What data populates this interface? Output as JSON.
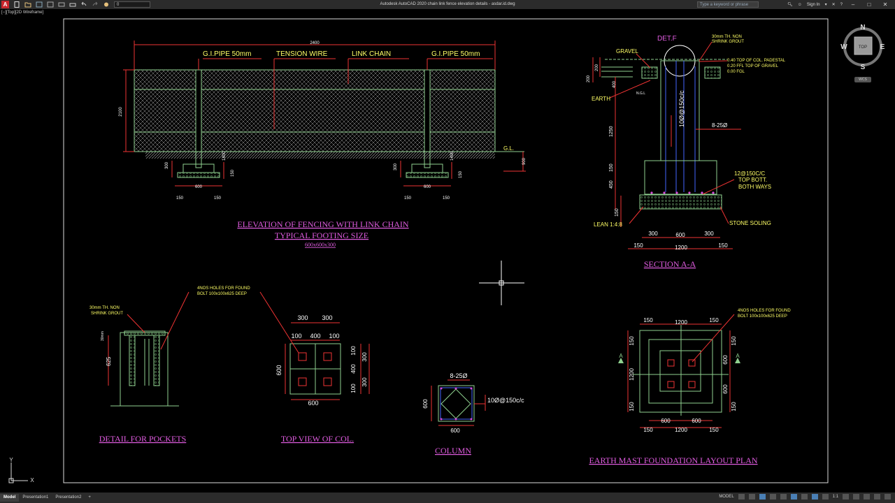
{
  "titlebar": {
    "app_logo": "A",
    "workspace": "0",
    "title": "Autodesk AutoCAD 2020   chain link fence elevation details - asdar.id.dwg",
    "search_placeholder": "Type a keyword or phrase",
    "sign_in": "Sign In"
  },
  "viewport_label": "[−][Top][2D Wireframe]",
  "viewcube": {
    "north": "N",
    "south": "S",
    "east": "E",
    "west": "W",
    "top": "TOP",
    "wcs": "WCS"
  },
  "ucs": {
    "x": "X",
    "y": "Y"
  },
  "statusbar": {
    "tabs": [
      "Model",
      "Presentation1",
      "Presentation2"
    ],
    "add": "+",
    "model": "MODEL",
    "scale": "1:1"
  },
  "drawing": {
    "elevation": {
      "top_dim": "2400",
      "height_dim": "2100",
      "labels": [
        "G.I.PIPE 50mm",
        "TENSION WIRE",
        "LINK CHAIN",
        "G.I.PIPE 50mm"
      ],
      "gl": "G.L.",
      "dims": [
        "300",
        "1400",
        "150",
        "600",
        "150",
        "150",
        "900"
      ],
      "title": "ELEVATION OF FENCING WITH LINK CHAIN",
      "subtitle": "TYPICAL FOOTING SIZE",
      "size": "600x600x300"
    },
    "section": {
      "det": "DET.F",
      "grout": "30mm TH. NON",
      "grout2": "SHRINK GROUT",
      "gravel": "GRAVEL",
      "earth": "EARTH",
      "ngl": "N.G.L",
      "lev1": "0.40 TOP OF COL. PADESTAL",
      "lev2": "0.20 FFL TOP OF GRAVEL",
      "lev3": "0.00 FGL",
      "stirrups": "10Ø@150c/c",
      "bars": "8-25Ø",
      "mesh1": "12@150C/C",
      "mesh2": "TOP BOTT.",
      "mesh3": "BOTH WAYS",
      "lean": "LEAN 1:4:8",
      "soling": "STONE SOLING",
      "vdims": [
        "200",
        "200",
        "400",
        "1250",
        "150",
        "450",
        "150"
      ],
      "hdims": [
        "300",
        "600",
        "300",
        "150",
        "1200",
        "150"
      ],
      "title": "SECTION A-A"
    },
    "pockets": {
      "note1": "4NOS HOLES FOR FOUND",
      "note2": "BOLT 100x100x625 DEEP",
      "grout1": "30mm TH. NON",
      "grout2": "SHRINK GROUT",
      "d1": "30mm",
      "d2": "625",
      "title": "DETAIL FOR POCKETS"
    },
    "topview": {
      "top": [
        "300",
        "300"
      ],
      "row": [
        "100",
        "400",
        "100"
      ],
      "left": "600",
      "right": [
        "100",
        "400",
        "100"
      ],
      "right2": [
        "300",
        "300"
      ],
      "bottom": "600",
      "title": "TOP VIEW OF COL."
    },
    "column": {
      "bars": "8-25Ø",
      "stirrups": "10Ø@150c/c",
      "left": "600",
      "bottom": "600",
      "title": "COLUMN"
    },
    "plan": {
      "note1": "4NOS HOLES FOR FOUND",
      "note2": "BOLT 100x100x625 DEEP",
      "top": [
        "150",
        "1200",
        "150"
      ],
      "left": [
        "150",
        "1200",
        "150"
      ],
      "right": [
        "150",
        "600",
        "600",
        "150"
      ],
      "bottom1": [
        "600",
        "600"
      ],
      "bottom2": [
        "150",
        "1200",
        "150"
      ],
      "marker": "A",
      "title": "EARTH MAST  FOUNDATION LAYOUT PLAN"
    }
  }
}
